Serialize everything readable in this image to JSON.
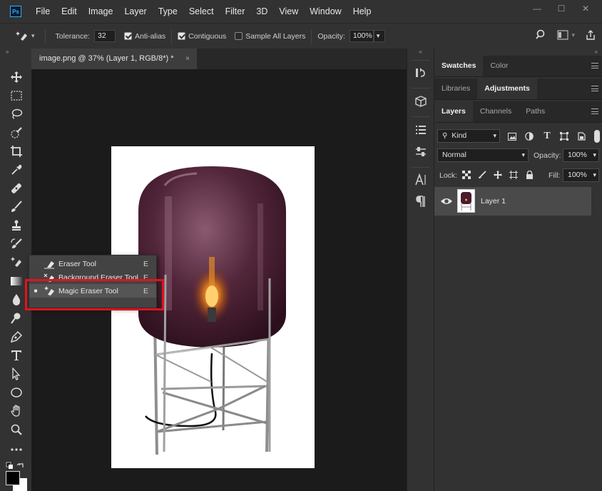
{
  "app": {
    "logo_text": "Ps"
  },
  "menu": [
    "File",
    "Edit",
    "Image",
    "Layer",
    "Type",
    "Select",
    "Filter",
    "3D",
    "View",
    "Window",
    "Help"
  ],
  "window_controls": {
    "minimize": "—",
    "maximize": "☐",
    "close": "✕"
  },
  "options": {
    "tolerance_label": "Tolerance:",
    "tolerance_value": "32",
    "anti_alias_label": "Anti-alias",
    "anti_alias_checked": true,
    "contiguous_label": "Contiguous",
    "contiguous_checked": true,
    "sample_all_label": "Sample All Layers",
    "sample_all_checked": false,
    "opacity_label": "Opacity:",
    "opacity_value": "100%"
  },
  "document_tab": {
    "title": "image.png @ 37% (Layer 1, RGB/8*) *",
    "close": "×"
  },
  "flyout": {
    "items": [
      {
        "label": "Eraser Tool",
        "shortcut": "E",
        "selected": false,
        "icon": "eraser-icon"
      },
      {
        "label": "Background Eraser Tool",
        "shortcut": "E",
        "selected": false,
        "icon": "background-eraser-icon"
      },
      {
        "label": "Magic Eraser Tool",
        "shortcut": "E",
        "selected": true,
        "icon": "magic-eraser-icon"
      }
    ]
  },
  "panels": {
    "group1_tabs": [
      "Swatches",
      "Color"
    ],
    "group2_tabs": [
      "Libraries",
      "Adjustments"
    ],
    "group3_tabs": [
      "Layers",
      "Channels",
      "Paths"
    ],
    "filter_kind": "Kind",
    "blend_mode": "Normal",
    "opacity_label": "Opacity:",
    "opacity_value": "100%",
    "lock_label": "Lock:",
    "fill_label": "Fill:",
    "fill_value": "100%",
    "layers": [
      {
        "name": "Layer 1",
        "visible": true
      }
    ]
  },
  "colors": {
    "accent_red": "#e0121e",
    "ps_blue": "#3fa9f5",
    "panel_bg": "#323232",
    "canvas_bg": "#1b1b1b"
  }
}
